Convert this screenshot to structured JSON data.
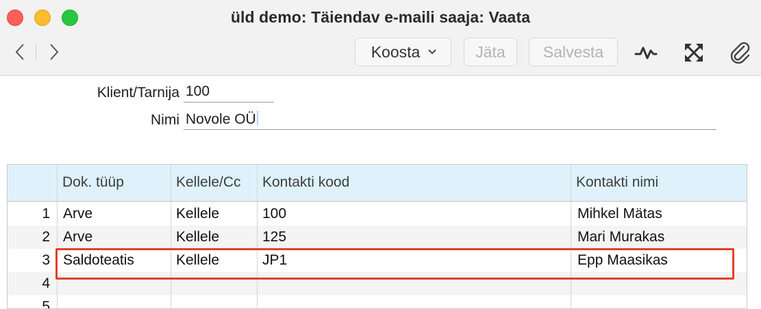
{
  "window": {
    "title": "üld demo: Täiendav e-maili saaja: Vaata"
  },
  "toolbar": {
    "koosta_label": "Koosta",
    "jata_label": "Jäta",
    "salvesta_label": "Salvesta"
  },
  "form": {
    "client_label": "Klient/Tarnija",
    "client_value": "100",
    "name_label": "Nimi",
    "name_value": "Novole OÜ"
  },
  "table": {
    "headers": [
      "Dok. tüüp",
      "Kellele/Cc",
      "Kontakti kood",
      "Kontakti nimi"
    ],
    "rows": [
      {
        "num": "1",
        "doc_type": "Arve",
        "to_cc": "Kellele",
        "contact_code": "100",
        "contact_name": "Mihkel Mätas"
      },
      {
        "num": "2",
        "doc_type": "Arve",
        "to_cc": "Kellele",
        "contact_code": "125",
        "contact_name": "Mari Murakas"
      },
      {
        "num": "3",
        "doc_type": "Saldoteatis",
        "to_cc": "Kellele",
        "contact_code": "JP1",
        "contact_name": "Epp Maasikas"
      },
      {
        "num": "4",
        "doc_type": "",
        "to_cc": "",
        "contact_code": "",
        "contact_name": ""
      },
      {
        "num": "5",
        "doc_type": "",
        "to_cc": "",
        "contact_code": "",
        "contact_name": ""
      }
    ]
  },
  "colors": {
    "highlight": "#e2402b",
    "header_bg": "#dff2fb"
  }
}
